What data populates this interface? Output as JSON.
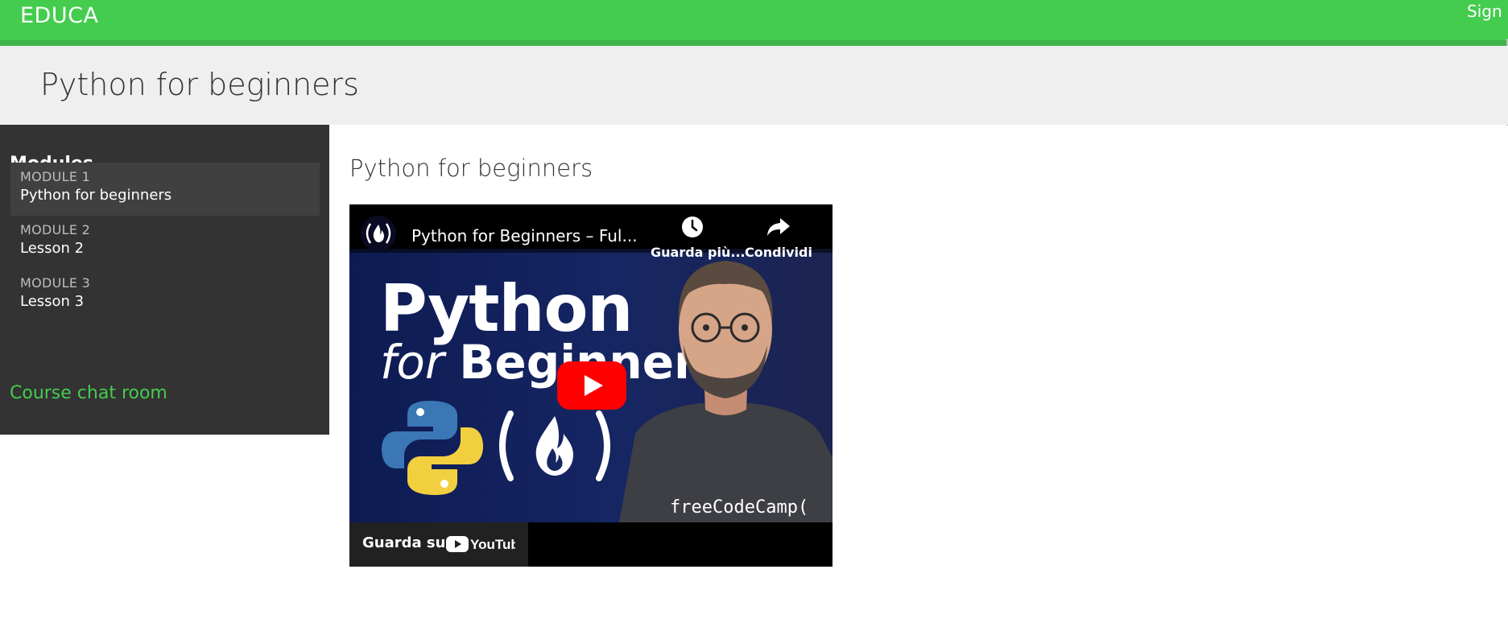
{
  "header": {
    "brand": "EDUCA",
    "sign_in": "Sign o",
    "color": "#44cc4e"
  },
  "page": {
    "title": "Python for beginners"
  },
  "sidebar": {
    "heading": "Modules",
    "modules": [
      {
        "number": "MODULE 1",
        "name": "Python for beginners",
        "active": true
      },
      {
        "number": "MODULE 2",
        "name": "Lesson 2",
        "active": false
      },
      {
        "number": "MODULE 3",
        "name": "Lesson 3",
        "active": false
      }
    ],
    "chat_link": "Course chat room"
  },
  "content": {
    "title": "Python for beginners",
    "video": {
      "title": "Python for Beginners – Ful...",
      "thumbnail_title": "Python",
      "thumbnail_sub_italic": "for",
      "thumbnail_sub_bold": "Beginners",
      "channel_watermark": "freeCodeCamp(",
      "watch_later_label": "Guarda più...",
      "share_label": "Condividi",
      "watch_on_label": "Guarda su",
      "platform": "YouTube",
      "icons": [
        "clock-icon",
        "share-arrow-icon",
        "play-icon",
        "youtube-logo-icon",
        "fcc-flame-icon",
        "python-logo-icon"
      ],
      "play_color": "#ff0000"
    }
  }
}
